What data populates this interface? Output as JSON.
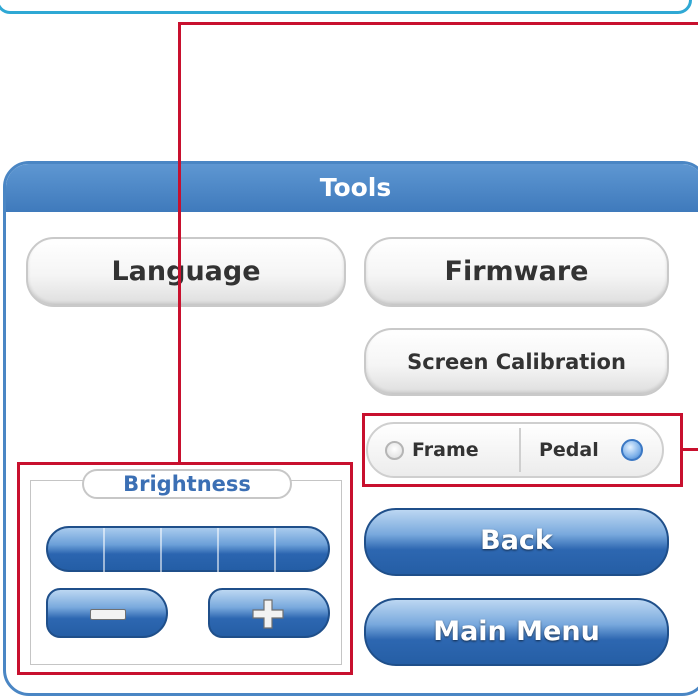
{
  "panel": {
    "title": "Tools"
  },
  "buttons": {
    "language": "Language",
    "firmware": "Firmware",
    "screen_calibration": "Screen Calibration",
    "back": "Back",
    "main_menu": "Main Menu"
  },
  "toggle": {
    "left_label": "Frame",
    "right_label": "Pedal",
    "selected": "Pedal"
  },
  "brightness": {
    "label": "Brightness",
    "segments": 5
  },
  "colors": {
    "accent_blue": "#3f7abc",
    "highlight_red": "#c8102e",
    "top_border": "#2fa8d4"
  }
}
